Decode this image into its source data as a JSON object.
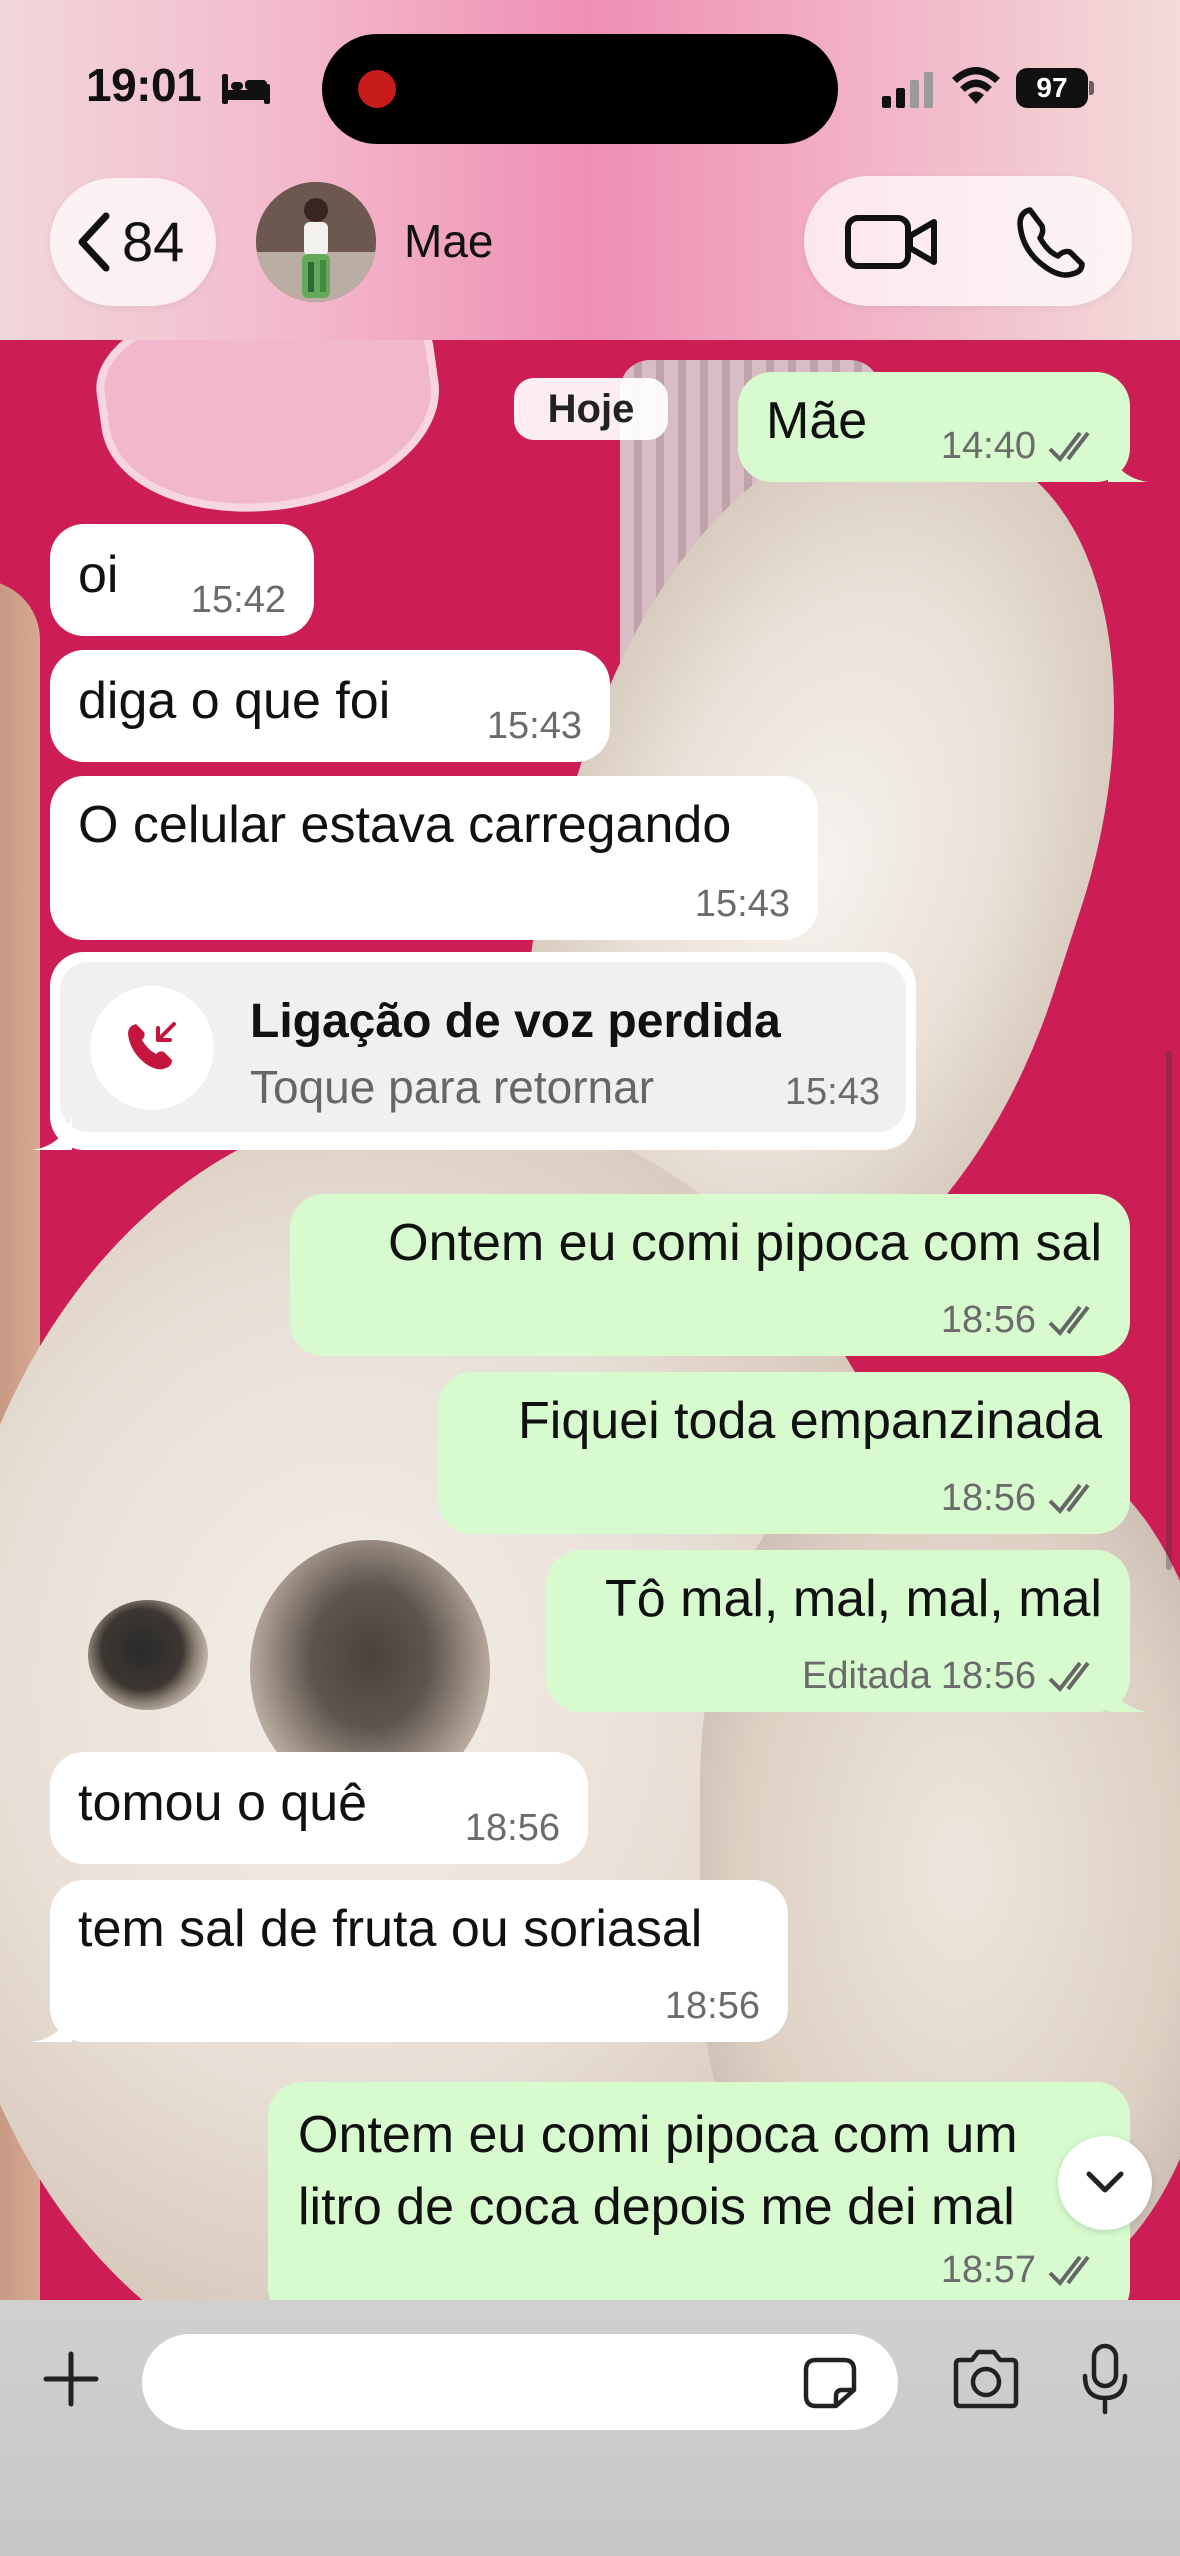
{
  "status_bar": {
    "time": "19:01",
    "battery": "97"
  },
  "header": {
    "back_count": "84",
    "contact_name": "Mae"
  },
  "chat": {
    "date_chip": "Hoje",
    "messages": [
      {
        "dir": "out",
        "text": "Mãe",
        "time": "14:40",
        "read": true
      },
      {
        "dir": "in",
        "text": "oi",
        "time": "15:42"
      },
      {
        "dir": "in",
        "text": "diga o que foi",
        "time": "15:43"
      },
      {
        "dir": "in",
        "text": "O celular estava carregando",
        "time": "15:43"
      },
      {
        "dir": "out",
        "text": "Ontem eu comi pipoca com sal",
        "time": "18:56",
        "read": true
      },
      {
        "dir": "out",
        "text": "Fiquei toda empanzinada",
        "time": "18:56",
        "read": true
      },
      {
        "dir": "out",
        "text": "Tô mal, mal, mal, mal",
        "time": "18:56",
        "edited": "Editada",
        "read": true
      },
      {
        "dir": "in",
        "text": "tomou o quê",
        "time": "18:56"
      },
      {
        "dir": "in",
        "text": "tem sal de fruta ou soriasal",
        "time": "18:56"
      },
      {
        "dir": "out",
        "line1": "Ontem eu comi pipoca com um",
        "line2": "litro de coca depois me dei mal",
        "time": "18:57",
        "read": true
      }
    ],
    "missed_call": {
      "title": "Ligação de voz perdida",
      "subtitle": "Toque para retornar",
      "time": "15:43"
    }
  },
  "icons": {
    "back": "chevron-left-icon",
    "video": "video-camera-icon",
    "phone": "phone-icon",
    "missed_call": "missed-call-icon",
    "attach": "plus-icon",
    "sticker": "sticker-icon",
    "camera": "camera-icon",
    "mic": "microphone-icon"
  },
  "colors": {
    "outgoing_bubble": "#d7fbcf",
    "incoming_bubble": "#ffffff",
    "missed_call_red": "#c4163f",
    "header_pink": "#ef8fb4"
  }
}
